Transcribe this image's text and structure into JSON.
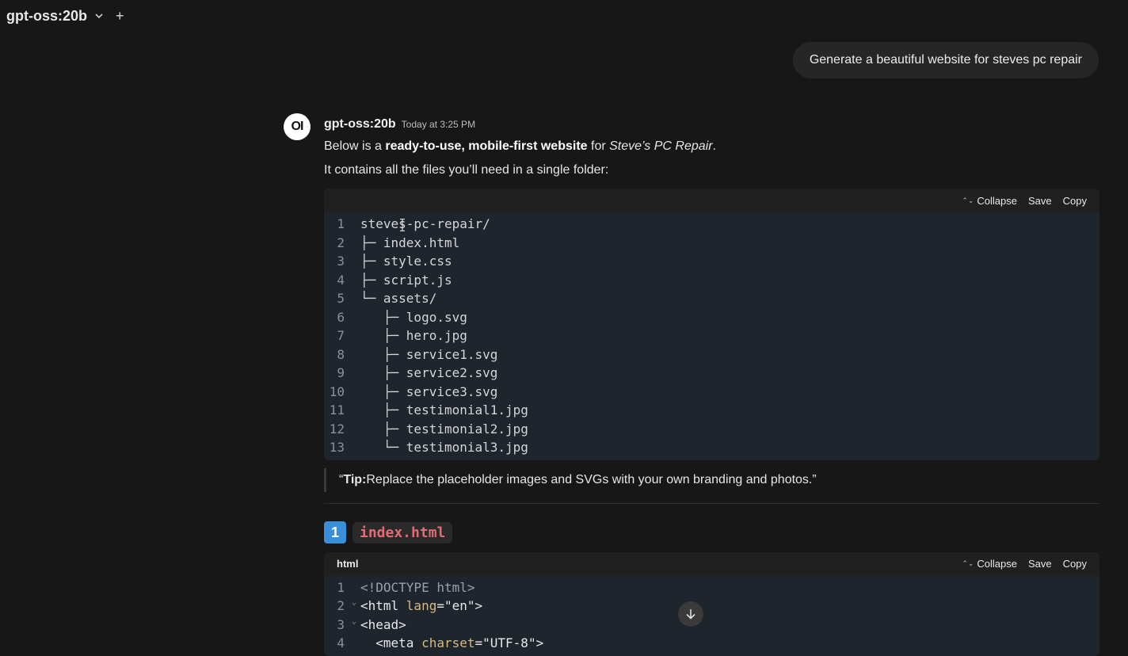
{
  "topbar": {
    "model": "gpt-oss:20b",
    "plus": "+"
  },
  "user_message": "Generate a beautiful website for steves pc repair",
  "assistant": {
    "avatar": "OI",
    "model": "gpt-oss:20b",
    "time": "Today at 3:25 PM",
    "intro_pre": "Below is a ",
    "intro_bold": "ready-to-use, mobile-first website",
    "intro_mid": " for ",
    "intro_italic": "Steve’s PC Repair",
    "intro_post": ".",
    "line2": "It contains all the files you’ll need in a single folder:"
  },
  "code_actions": {
    "collapse": "Collapse",
    "save": "Save",
    "copy": "Copy"
  },
  "tree_lines": [
    {
      "n": "1",
      "t": "steves-pc-repair/"
    },
    {
      "n": "2",
      "t": "├─ index.html"
    },
    {
      "n": "3",
      "t": "├─ style.css"
    },
    {
      "n": "4",
      "t": "├─ script.js"
    },
    {
      "n": "5",
      "t": "└─ assets/"
    },
    {
      "n": "6",
      "t": "   ├─ logo.svg"
    },
    {
      "n": "7",
      "t": "   ├─ hero.jpg"
    },
    {
      "n": "8",
      "t": "   ├─ service1.svg"
    },
    {
      "n": "9",
      "t": "   ├─ service2.svg"
    },
    {
      "n": "10",
      "t": "   ├─ service3.svg"
    },
    {
      "n": "11",
      "t": "   ├─ testimonial1.jpg"
    },
    {
      "n": "12",
      "t": "   ├─ testimonial2.jpg"
    },
    {
      "n": "13",
      "t": "   └─ testimonial3.jpg"
    }
  ],
  "tip": {
    "open": "“",
    "label": "Tip:",
    "text": " Replace the placeholder images and SVGs with your own branding and photos.",
    "close": " ”"
  },
  "section": {
    "number": "1",
    "filename": "index.html"
  },
  "html_block": {
    "lang": "html",
    "lines": [
      {
        "n": "1",
        "doctype": "<!DOCTYPE html>"
      },
      {
        "n": "2",
        "tag_open": "<html ",
        "attr": "lang",
        "eq": "=",
        "val": "\"en\"",
        "tag_close": ">"
      },
      {
        "n": "3",
        "tag_open": "<head>"
      },
      {
        "n": "4",
        "tag_open": "  <meta ",
        "attr": "charset",
        "eq": "=",
        "val": "\"UTF-8\"",
        "tag_close": ">"
      }
    ]
  },
  "icons": {
    "chevron": "chevron-down-icon",
    "scroll": "arrow-down-icon",
    "cursor": "text-cursor-icon"
  }
}
